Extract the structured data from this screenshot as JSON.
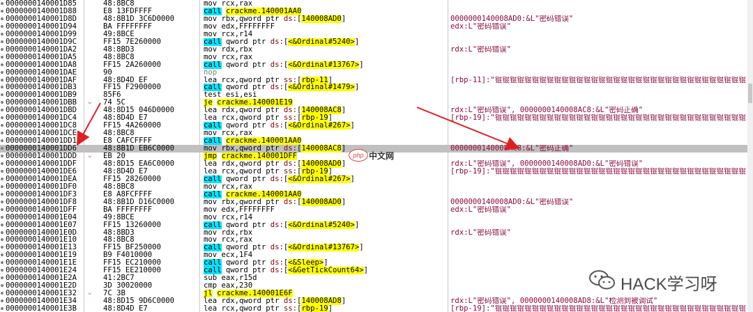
{
  "rows": [
    {
      "addr": "0000000140001D85",
      "jmp": "",
      "bytes": "48:8BC8",
      "asm": [
        [
          "t",
          "mov "
        ],
        [
          "t",
          "rcx,rax"
        ]
      ],
      "cmt": ""
    },
    {
      "addr": "0000000140001D88",
      "jmp": "",
      "bytes": "E8 13FDFFFF",
      "asm": [
        [
          "call",
          "call"
        ],
        [
          "t",
          " "
        ],
        [
          "op",
          "crackme.140001AA0"
        ]
      ],
      "cmt": ""
    },
    {
      "addr": "0000000140001D8D",
      "jmp": "",
      "bytes": "48:8B1D 3C6D0000",
      "asm": [
        [
          "t",
          "mov rbx,qword ptr "
        ],
        [
          "seg",
          "ds:"
        ],
        [
          "t",
          "["
        ],
        [
          "op",
          "140008AD0"
        ],
        [
          "t",
          "]"
        ]
      ],
      "cmt": "0000000140008AD0:&L\"密码错误\""
    },
    {
      "addr": "0000000140001D94",
      "jmp": "",
      "bytes": "BA FFFFFFFF",
      "asm": [
        [
          "t",
          "mov edx,FFFFFFFF"
        ]
      ],
      "cmt": "edx:L\"密码错误\""
    },
    {
      "addr": "0000000140001D99",
      "jmp": "",
      "bytes": "49:8BCE",
      "asm": [
        [
          "t",
          "mov rcx,r14"
        ]
      ],
      "cmt": ""
    },
    {
      "addr": "0000000140001D9C",
      "jmp": "",
      "bytes": "FF15 7E260000",
      "asm": [
        [
          "call",
          "call"
        ],
        [
          "t",
          " qword ptr "
        ],
        [
          "seg",
          "ds:"
        ],
        [
          "t",
          "["
        ],
        [
          "op",
          "<&Ordinal#5240>"
        ],
        [
          "t",
          "]"
        ]
      ],
      "cmt": ""
    },
    {
      "addr": "0000000140001DA2",
      "jmp": "",
      "bytes": "48:8BD3",
      "asm": [
        [
          "t",
          "mov rdx,rbx"
        ]
      ],
      "cmt": "rdx:L\"密码错误\""
    },
    {
      "addr": "0000000140001DA5",
      "jmp": "",
      "bytes": "48:8BC8",
      "asm": [
        [
          "t",
          "mov rcx,rax"
        ]
      ],
      "cmt": ""
    },
    {
      "addr": "0000000140001DA8",
      "jmp": "",
      "bytes": "FF15 2A260000",
      "asm": [
        [
          "call",
          "call"
        ],
        [
          "t",
          " qword ptr "
        ],
        [
          "seg",
          "ds:"
        ],
        [
          "t",
          "["
        ],
        [
          "op",
          "<&Ordinal#13767>"
        ],
        [
          "t",
          "]"
        ]
      ],
      "cmt": ""
    },
    {
      "addr": "0000000140001DAE",
      "jmp": "",
      "bytes": "90",
      "asm": [
        [
          "nop",
          "nop"
        ]
      ],
      "cmt": ""
    },
    {
      "addr": "0000000140001DAF",
      "jmp": "",
      "bytes": "48:8D4D EF",
      "asm": [
        [
          "t",
          "lea rcx,qword ptr "
        ],
        [
          "seg",
          "ss:"
        ],
        [
          "t",
          "["
        ],
        [
          "imm",
          "rbp-11"
        ],
        [
          "t",
          "]"
        ]
      ],
      "cmt": "[rbp-11]:\"锟锟锟锟锟锟锟锟锟锟锟锟锟锟锟锟锟锟锟锟锟锟锟锟锟锟锟锟锟锟锟锟锟锟"
    },
    {
      "addr": "0000000140001DB3",
      "jmp": "",
      "bytes": "FF15 F2900000",
      "asm": [
        [
          "call",
          "call"
        ],
        [
          "t",
          " qword ptr "
        ],
        [
          "seg",
          "ds:"
        ],
        [
          "t",
          "["
        ],
        [
          "op",
          "<&Ordinal#1479>"
        ],
        [
          "t",
          "]"
        ]
      ],
      "cmt": ""
    },
    {
      "addr": "0000000140001DB9",
      "jmp": "",
      "bytes": "85F6",
      "asm": [
        [
          "t",
          "test esi,esi"
        ]
      ],
      "cmt": ""
    },
    {
      "addr": "0000000140001DBB",
      "jmp": "⌵",
      "bytes": "74 5C",
      "asm": [
        [
          "jcc",
          "je"
        ],
        [
          "t",
          " "
        ],
        [
          "op",
          "crackme.140001E19"
        ]
      ],
      "cmt": ""
    },
    {
      "addr": "0000000140001DBD",
      "jmp": "",
      "bytes": "48:8D15 046D0000",
      "asm": [
        [
          "t",
          "lea rdx,qword ptr "
        ],
        [
          "seg",
          "ds:"
        ],
        [
          "t",
          "["
        ],
        [
          "op",
          "140008AC8"
        ],
        [
          "t",
          "]"
        ]
      ],
      "cmt": "rdx:L\"密码错误\", 0000000140008AC8:&L\"密码正确\""
    },
    {
      "addr": "0000000140001DC4",
      "jmp": "",
      "bytes": "48:8D4D E7",
      "asm": [
        [
          "t",
          "lea rcx,qword ptr "
        ],
        [
          "seg",
          "ss:"
        ],
        [
          "t",
          "["
        ],
        [
          "imm",
          "rbp-19"
        ],
        [
          "t",
          "]"
        ]
      ],
      "cmt": "[rbp-19]:\"锟锟锟锟锟锟锟锟锟锟锟锟锟锟锟锟锟锟锟锟锟锟锟锟锟锟锟锟锟锟锟锟锟锟"
    },
    {
      "addr": "0000000140001DC8",
      "jmp": "",
      "bytes": "FF15 4A260000",
      "asm": [
        [
          "call",
          "call"
        ],
        [
          "t",
          " qword ptr "
        ],
        [
          "seg",
          "ds:"
        ],
        [
          "t",
          "["
        ],
        [
          "op",
          "<&Ordinal#267>"
        ],
        [
          "t",
          "]"
        ]
      ],
      "cmt": ""
    },
    {
      "addr": "0000000140001DCE",
      "jmp": "",
      "bytes": "48:8BC8",
      "asm": [
        [
          "t",
          "mov rcx,rax"
        ]
      ],
      "cmt": ""
    },
    {
      "addr": "0000000140001DD1",
      "jmp": "",
      "bytes": "E8 CAFCFFFF",
      "asm": [
        [
          "call",
          "call"
        ],
        [
          "t",
          " "
        ],
        [
          "op",
          "crackme.140001AA0"
        ]
      ],
      "cmt": ""
    },
    {
      "addr": "0000000140001DD6",
      "jmp": "",
      "bytes": "48:8B1D EB6C0000",
      "asm": [
        [
          "t",
          "mov rbx,qword ptr "
        ],
        [
          "seg",
          "ds:"
        ],
        [
          "t",
          "["
        ],
        [
          "op",
          "140008AC8"
        ],
        [
          "t",
          "]"
        ]
      ],
      "cmt": "0000000140008AC8:&L\"密码正确\"",
      "cur": true
    },
    {
      "addr": "0000000140001DDD",
      "jmp": "⌵",
      "bytes": "EB 20",
      "asm": [
        [
          "jcc",
          "jmp"
        ],
        [
          "t",
          " "
        ],
        [
          "op",
          "crackme.140001DFF"
        ]
      ],
      "cmt": ""
    },
    {
      "addr": "0000000140001DDF",
      "jmp": "",
      "bytes": "48:8D15 EA6C0000",
      "asm": [
        [
          "t",
          "lea rdx,qword ptr "
        ],
        [
          "seg",
          "ds:"
        ],
        [
          "t",
          "["
        ],
        [
          "op",
          "140008AD0"
        ],
        [
          "t",
          "]"
        ]
      ],
      "cmt": "rdx:L\"密码错误\", 0000000140008AD0:&L\"密码错误\""
    },
    {
      "addr": "0000000140001DE6",
      "jmp": "",
      "bytes": "48:8D4D E7",
      "asm": [
        [
          "t",
          "lea rcx,qword ptr "
        ],
        [
          "seg",
          "ss:"
        ],
        [
          "t",
          "["
        ],
        [
          "imm",
          "rbp-19"
        ],
        [
          "t",
          "]"
        ]
      ],
      "cmt": "[rbp-19]:\"锟锟锟锟锟锟锟锟锟锟锟锟锟锟锟锟锟锟锟锟锟锟锟锟锟锟锟锟锟锟锟锟锟锟"
    },
    {
      "addr": "0000000140001DEA",
      "jmp": "",
      "bytes": "FF15 28260000",
      "asm": [
        [
          "call",
          "call"
        ],
        [
          "t",
          " qword ptr "
        ],
        [
          "seg",
          "ds:"
        ],
        [
          "t",
          "["
        ],
        [
          "op",
          "<&Ordinal#267>"
        ],
        [
          "t",
          "]"
        ]
      ],
      "cmt": ""
    },
    {
      "addr": "0000000140001DF0",
      "jmp": "",
      "bytes": "48:8BC8",
      "asm": [
        [
          "t",
          "mov rcx,rax"
        ]
      ],
      "cmt": ""
    },
    {
      "addr": "0000000140001DF3",
      "jmp": "",
      "bytes": "E8 A8FCFFFF",
      "asm": [
        [
          "call",
          "call"
        ],
        [
          "t",
          " "
        ],
        [
          "op",
          "crackme.140001AA0"
        ]
      ],
      "cmt": ""
    },
    {
      "addr": "0000000140001DF8",
      "jmp": "",
      "bytes": "48:8B1D D16C0000",
      "asm": [
        [
          "t",
          "mov rbx,qword ptr "
        ],
        [
          "seg",
          "ds:"
        ],
        [
          "t",
          "["
        ],
        [
          "op",
          "140008AD0"
        ],
        [
          "t",
          "]"
        ]
      ],
      "cmt": "0000000140008AD0:&L\"密码错误\""
    },
    {
      "addr": "0000000140001DFF",
      "jmp": "",
      "bytes": "BA FFFFFFFF",
      "asm": [
        [
          "t",
          "mov edx,FFFFFFFF"
        ]
      ],
      "cmt": "edx:L\"密码错误\""
    },
    {
      "addr": "0000000140001E04",
      "jmp": "",
      "bytes": "49:8BCE",
      "asm": [
        [
          "t",
          "mov rcx,r14"
        ]
      ],
      "cmt": ""
    },
    {
      "addr": "0000000140001E07",
      "jmp": "",
      "bytes": "FF15 13260000",
      "asm": [
        [
          "call",
          "call"
        ],
        [
          "t",
          " qword ptr "
        ],
        [
          "seg",
          "ds:"
        ],
        [
          "t",
          "["
        ],
        [
          "op",
          "<&Ordinal#5240>"
        ],
        [
          "t",
          "]"
        ]
      ],
      "cmt": ""
    },
    {
      "addr": "0000000140001E0D",
      "jmp": "",
      "bytes": "48:8BD3",
      "asm": [
        [
          "t",
          "mov rdx,rbx"
        ]
      ],
      "cmt": "rdx:L\"密码错误\""
    },
    {
      "addr": "0000000140001E10",
      "jmp": "",
      "bytes": "48:8BC8",
      "asm": [
        [
          "t",
          "mov rcx,rax"
        ]
      ],
      "cmt": ""
    },
    {
      "addr": "0000000140001E13",
      "jmp": "",
      "bytes": "FF15 BF250000",
      "asm": [
        [
          "call",
          "call"
        ],
        [
          "t",
          " qword ptr "
        ],
        [
          "seg",
          "ds:"
        ],
        [
          "t",
          "["
        ],
        [
          "op",
          "<&Ordinal#13767>"
        ],
        [
          "t",
          "]"
        ]
      ],
      "cmt": ""
    },
    {
      "addr": "0000000140001E19",
      "jmp": "",
      "bytes": "B9 F4010000",
      "asm": [
        [
          "t",
          "mov ecx,1F4"
        ]
      ],
      "cmt": ""
    },
    {
      "addr": "0000000140001E1E",
      "jmp": "",
      "bytes": "FF15 EC210000",
      "asm": [
        [
          "call",
          "call"
        ],
        [
          "t",
          " qword ptr "
        ],
        [
          "seg",
          "ds:"
        ],
        [
          "t",
          "["
        ],
        [
          "op",
          "<&Sleep>"
        ],
        [
          "t",
          "]"
        ]
      ],
      "cmt": ""
    },
    {
      "addr": "0000000140001E24",
      "jmp": "",
      "bytes": "FF15 EE210000",
      "asm": [
        [
          "call",
          "call"
        ],
        [
          "t",
          " qword ptr "
        ],
        [
          "seg",
          "ds:"
        ],
        [
          "t",
          "["
        ],
        [
          "op",
          "<&GetTickCount64>"
        ],
        [
          "t",
          "]"
        ]
      ],
      "cmt": ""
    },
    {
      "addr": "0000000140001E2A",
      "jmp": "",
      "bytes": "41:2BC7",
      "asm": [
        [
          "t",
          "sub eax,r15d"
        ]
      ],
      "cmt": ""
    },
    {
      "addr": "0000000140001E2D",
      "jmp": "",
      "bytes": "3D 30020000",
      "asm": [
        [
          "t",
          "cmp eax,230"
        ]
      ],
      "cmt": ""
    },
    {
      "addr": "0000000140001E32",
      "jmp": "⌵",
      "bytes": "7C 3B",
      "asm": [
        [
          "jcc",
          "jl"
        ],
        [
          "t",
          " "
        ],
        [
          "op",
          "crackme.140001E6F"
        ]
      ],
      "cmt": ""
    },
    {
      "addr": "0000000140001E34",
      "jmp": "",
      "bytes": "48:8D15 9D6C0000",
      "asm": [
        [
          "t",
          "lea rdx,qword ptr "
        ],
        [
          "seg",
          "ds:"
        ],
        [
          "t",
          "["
        ],
        [
          "op",
          "140008AD8"
        ],
        [
          "t",
          "]"
        ]
      ],
      "cmt": "rdx:L\"密码错误\", 0000000140008AD8:&L\"检测到被调试\""
    },
    {
      "addr": "0000000140001E3B",
      "jmp": "",
      "bytes": "48:8D4D E7",
      "asm": [
        [
          "t",
          "lea rcx,qword ptr "
        ],
        [
          "seg",
          "ss:"
        ],
        [
          "t",
          "["
        ],
        [
          "imm",
          "rbp-19"
        ],
        [
          "t",
          "]"
        ]
      ],
      "cmt": "[rbp-19]:\"锟锟锟锟锟锟锟锟锟锟锟锟锟锟锟锟锟锟锟锟锟锟锟锟锟锟锟锟锟锟锟锟锟锟"
    }
  ],
  "watermarks": {
    "php_logo": "php",
    "php_site": "中文网",
    "hack": "HACK学习呀"
  },
  "colors": {
    "call_highlight": "#00e5ff",
    "jump_highlight": "#ffff00",
    "current_row": "#c0c0c0",
    "comment_text": "#8b0a3c",
    "arrow": "#e02020"
  }
}
